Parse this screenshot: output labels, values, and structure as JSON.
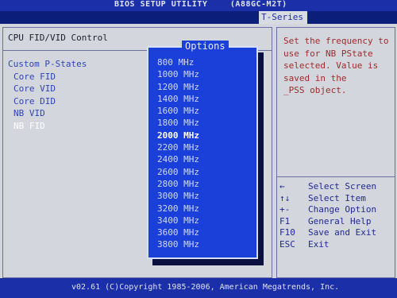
{
  "header": {
    "title": "BIOS SETUP UTILITY",
    "board": "(A88GC-M2T)",
    "tab": "T-Series"
  },
  "left": {
    "section_title": "CPU FID/VID Control",
    "items": [
      {
        "label": "Custom P-States",
        "level": 0
      },
      {
        "label": "Core FID",
        "level": 1
      },
      {
        "label": "Core VID",
        "level": 1
      },
      {
        "label": "Core DID",
        "level": 1
      },
      {
        "label": "NB VID",
        "level": 1
      },
      {
        "label": "NB FID",
        "level": 1
      }
    ]
  },
  "popup": {
    "title": "Options",
    "options": [
      "800 MHz",
      "1000 MHz",
      "1200 MHz",
      "1400 MHz",
      "1600 MHz",
      "1800 MHz",
      "2000 MHz",
      "2200 MHz",
      "2400 MHz",
      "2600 MHz",
      "2800 MHz",
      "3000 MHz",
      "3200 MHz",
      "3400 MHz",
      "3600 MHz",
      "3800 MHz"
    ],
    "selected": "2000 MHz"
  },
  "help": {
    "lines": [
      "Set the frequency to",
      "use for NB PState",
      "selected. Value is",
      "saved in the",
      "_PSS object."
    ]
  },
  "keys": [
    {
      "key": "←",
      "desc": "Select Screen"
    },
    {
      "key": "↑↓",
      "desc": "Select Item"
    },
    {
      "key": "+-",
      "desc": "Change Option"
    },
    {
      "key": "F1",
      "desc": "General Help"
    },
    {
      "key": "F10",
      "desc": "Save and Exit"
    },
    {
      "key": "ESC",
      "desc": "Exit"
    }
  ],
  "footer": {
    "copyright": "v02.61 (C)Copyright 1985-2006, American Megatrends, Inc."
  }
}
